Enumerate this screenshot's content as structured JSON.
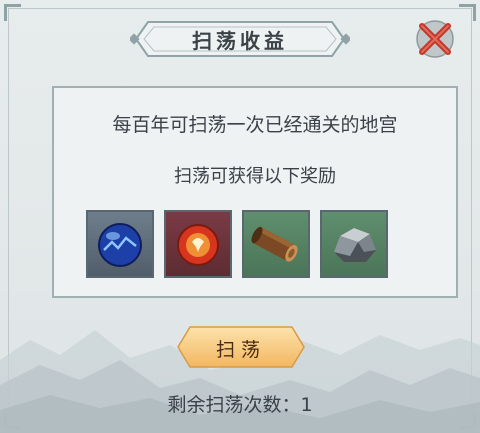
{
  "dialog": {
    "title": "扫荡收益",
    "description": "每百年可扫荡一次已经通关的地宫",
    "rewards_caption": "扫荡可获得以下奖励",
    "rewards": [
      {
        "icon": "blue-orb-icon",
        "frame_color": "#6f7e8c"
      },
      {
        "icon": "red-spirit-orb-icon",
        "frame_color": "#7a3b45"
      },
      {
        "icon": "wood-log-icon",
        "frame_color": "#5f8f6e"
      },
      {
        "icon": "iron-ore-icon",
        "frame_color": "#5f8f6e"
      }
    ],
    "sweep_button_label": "扫荡",
    "remaining_text": "剩余扫荡次数：1"
  },
  "colors": {
    "button": "#f7c67a",
    "close": "#c0392b",
    "panel_border": "#9fb0b3"
  }
}
